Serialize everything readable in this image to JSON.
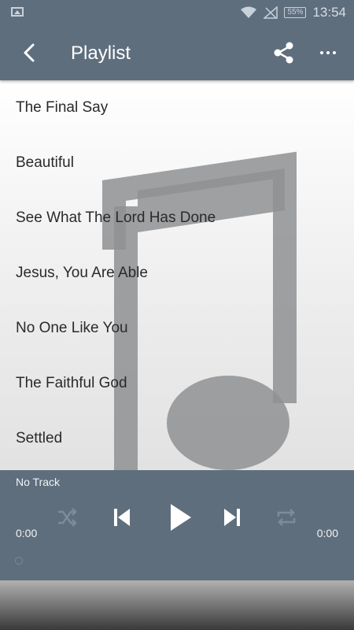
{
  "status_bar": {
    "time": "13:54",
    "battery": "55%",
    "icons": [
      "image-icon",
      "wifi-icon",
      "signal-icon",
      "battery-icon"
    ]
  },
  "app_bar": {
    "title": "Playlist",
    "icons": [
      "back-arrow-icon",
      "share-icon",
      "more-dots-icon"
    ]
  },
  "playlist": {
    "items": [
      "The Final Say",
      "Beautiful",
      "See What The Lord Has Done",
      "Jesus, You Are Able",
      "No One Like You",
      "The Faithful God",
      "Settled"
    ]
  },
  "player": {
    "now_playing": "No Track",
    "elapsed": "0:00",
    "duration": "0:00",
    "icons": [
      "shuffle-icon",
      "previous-icon",
      "play-icon",
      "next-icon",
      "repeat-icon"
    ]
  },
  "colors": {
    "bar": "#5f6e7d",
    "text": "#2a2a2a",
    "watermark": "#8f9193"
  }
}
